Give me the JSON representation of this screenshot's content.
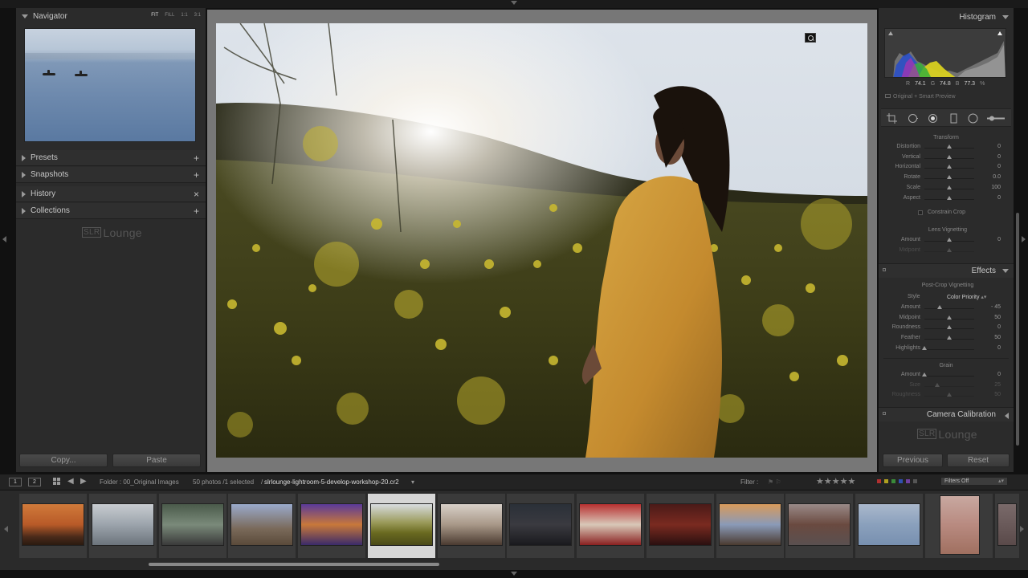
{
  "navigator": {
    "title": "Navigator",
    "zoom": [
      "FIT",
      "FILL",
      "1:1",
      "3:1"
    ]
  },
  "left_panels": [
    {
      "label": "Presets",
      "action": "+"
    },
    {
      "label": "Snapshots",
      "action": "+"
    },
    {
      "label": "History",
      "action": "×"
    },
    {
      "label": "Collections",
      "action": "+"
    }
  ],
  "logo": {
    "bracket": "SLR",
    "text": "Lounge"
  },
  "left_buttons": {
    "copy": "Copy...",
    "paste": "Paste"
  },
  "histogram": {
    "title": "Histogram",
    "r_label": "R",
    "r": "74.1",
    "g_label": "G",
    "g": "74.8",
    "b_label": "B",
    "b": "77.3",
    "unit": "%",
    "preview_state": "Original + Smart Preview"
  },
  "transform": {
    "title": "Transform",
    "sliders": [
      {
        "label": "Distortion",
        "value": "0",
        "pos": 0.5
      },
      {
        "label": "Vertical",
        "value": "0",
        "pos": 0.5
      },
      {
        "label": "Horizontal",
        "value": "0",
        "pos": 0.5
      },
      {
        "label": "Rotate",
        "value": "0.0",
        "pos": 0.5
      },
      {
        "label": "Scale",
        "value": "100",
        "pos": 0.5
      },
      {
        "label": "Aspect",
        "value": "0",
        "pos": 0.5
      }
    ],
    "constrain": "Constrain Crop"
  },
  "lens_vignetting": {
    "title": "Lens Vignetting",
    "sliders": [
      {
        "label": "Amount",
        "value": "0",
        "pos": 0.5,
        "dim": false
      },
      {
        "label": "Midpoint",
        "value": "",
        "pos": 0.5,
        "dim": true
      }
    ]
  },
  "effects": {
    "title": "Effects",
    "post_crop_title": "Post-Crop Vignetting",
    "style_label": "Style",
    "style_value": "Color Priority",
    "sliders": [
      {
        "label": "Amount",
        "value": "- 45",
        "pos": 0.3,
        "dim": false
      },
      {
        "label": "Midpoint",
        "value": "50",
        "pos": 0.5,
        "dim": false
      },
      {
        "label": "Roundness",
        "value": "0",
        "pos": 0.5,
        "dim": false
      },
      {
        "label": "Feather",
        "value": "50",
        "pos": 0.5,
        "dim": false
      },
      {
        "label": "Highlights",
        "value": "0",
        "pos": 0.0,
        "dim": false
      }
    ],
    "grain_title": "Grain",
    "grain_sliders": [
      {
        "label": "Amount",
        "value": "0",
        "pos": 0.0,
        "dim": false
      },
      {
        "label": "Size",
        "value": "25",
        "pos": 0.25,
        "dim": true
      },
      {
        "label": "Roughness",
        "value": "50",
        "pos": 0.5,
        "dim": true
      }
    ]
  },
  "camera_calibration": {
    "title": "Camera Calibration"
  },
  "right_buttons": {
    "previous": "Previous",
    "reset": "Reset"
  },
  "film_toolbar": {
    "screen1": "1",
    "screen2": "2",
    "folder": "Folder : 00_Original Images",
    "count": "50 photos /1 selected",
    "path_prefix": "/",
    "filename": "slrlounge-lightroom-5-develop-workshop-20.cr2",
    "filter_label": "Filter :",
    "filters_off": "Filters Off",
    "stars": "★★★★★"
  },
  "colors": {
    "panel_bg": "#2b2b2b",
    "flag_red": "#b03030",
    "flag_yellow": "#b0a020",
    "flag_green": "#3a8a3a",
    "flag_blue": "#3050b0",
    "flag_purple": "#7040a0"
  },
  "filmstrip": {
    "selected_index": 5
  }
}
